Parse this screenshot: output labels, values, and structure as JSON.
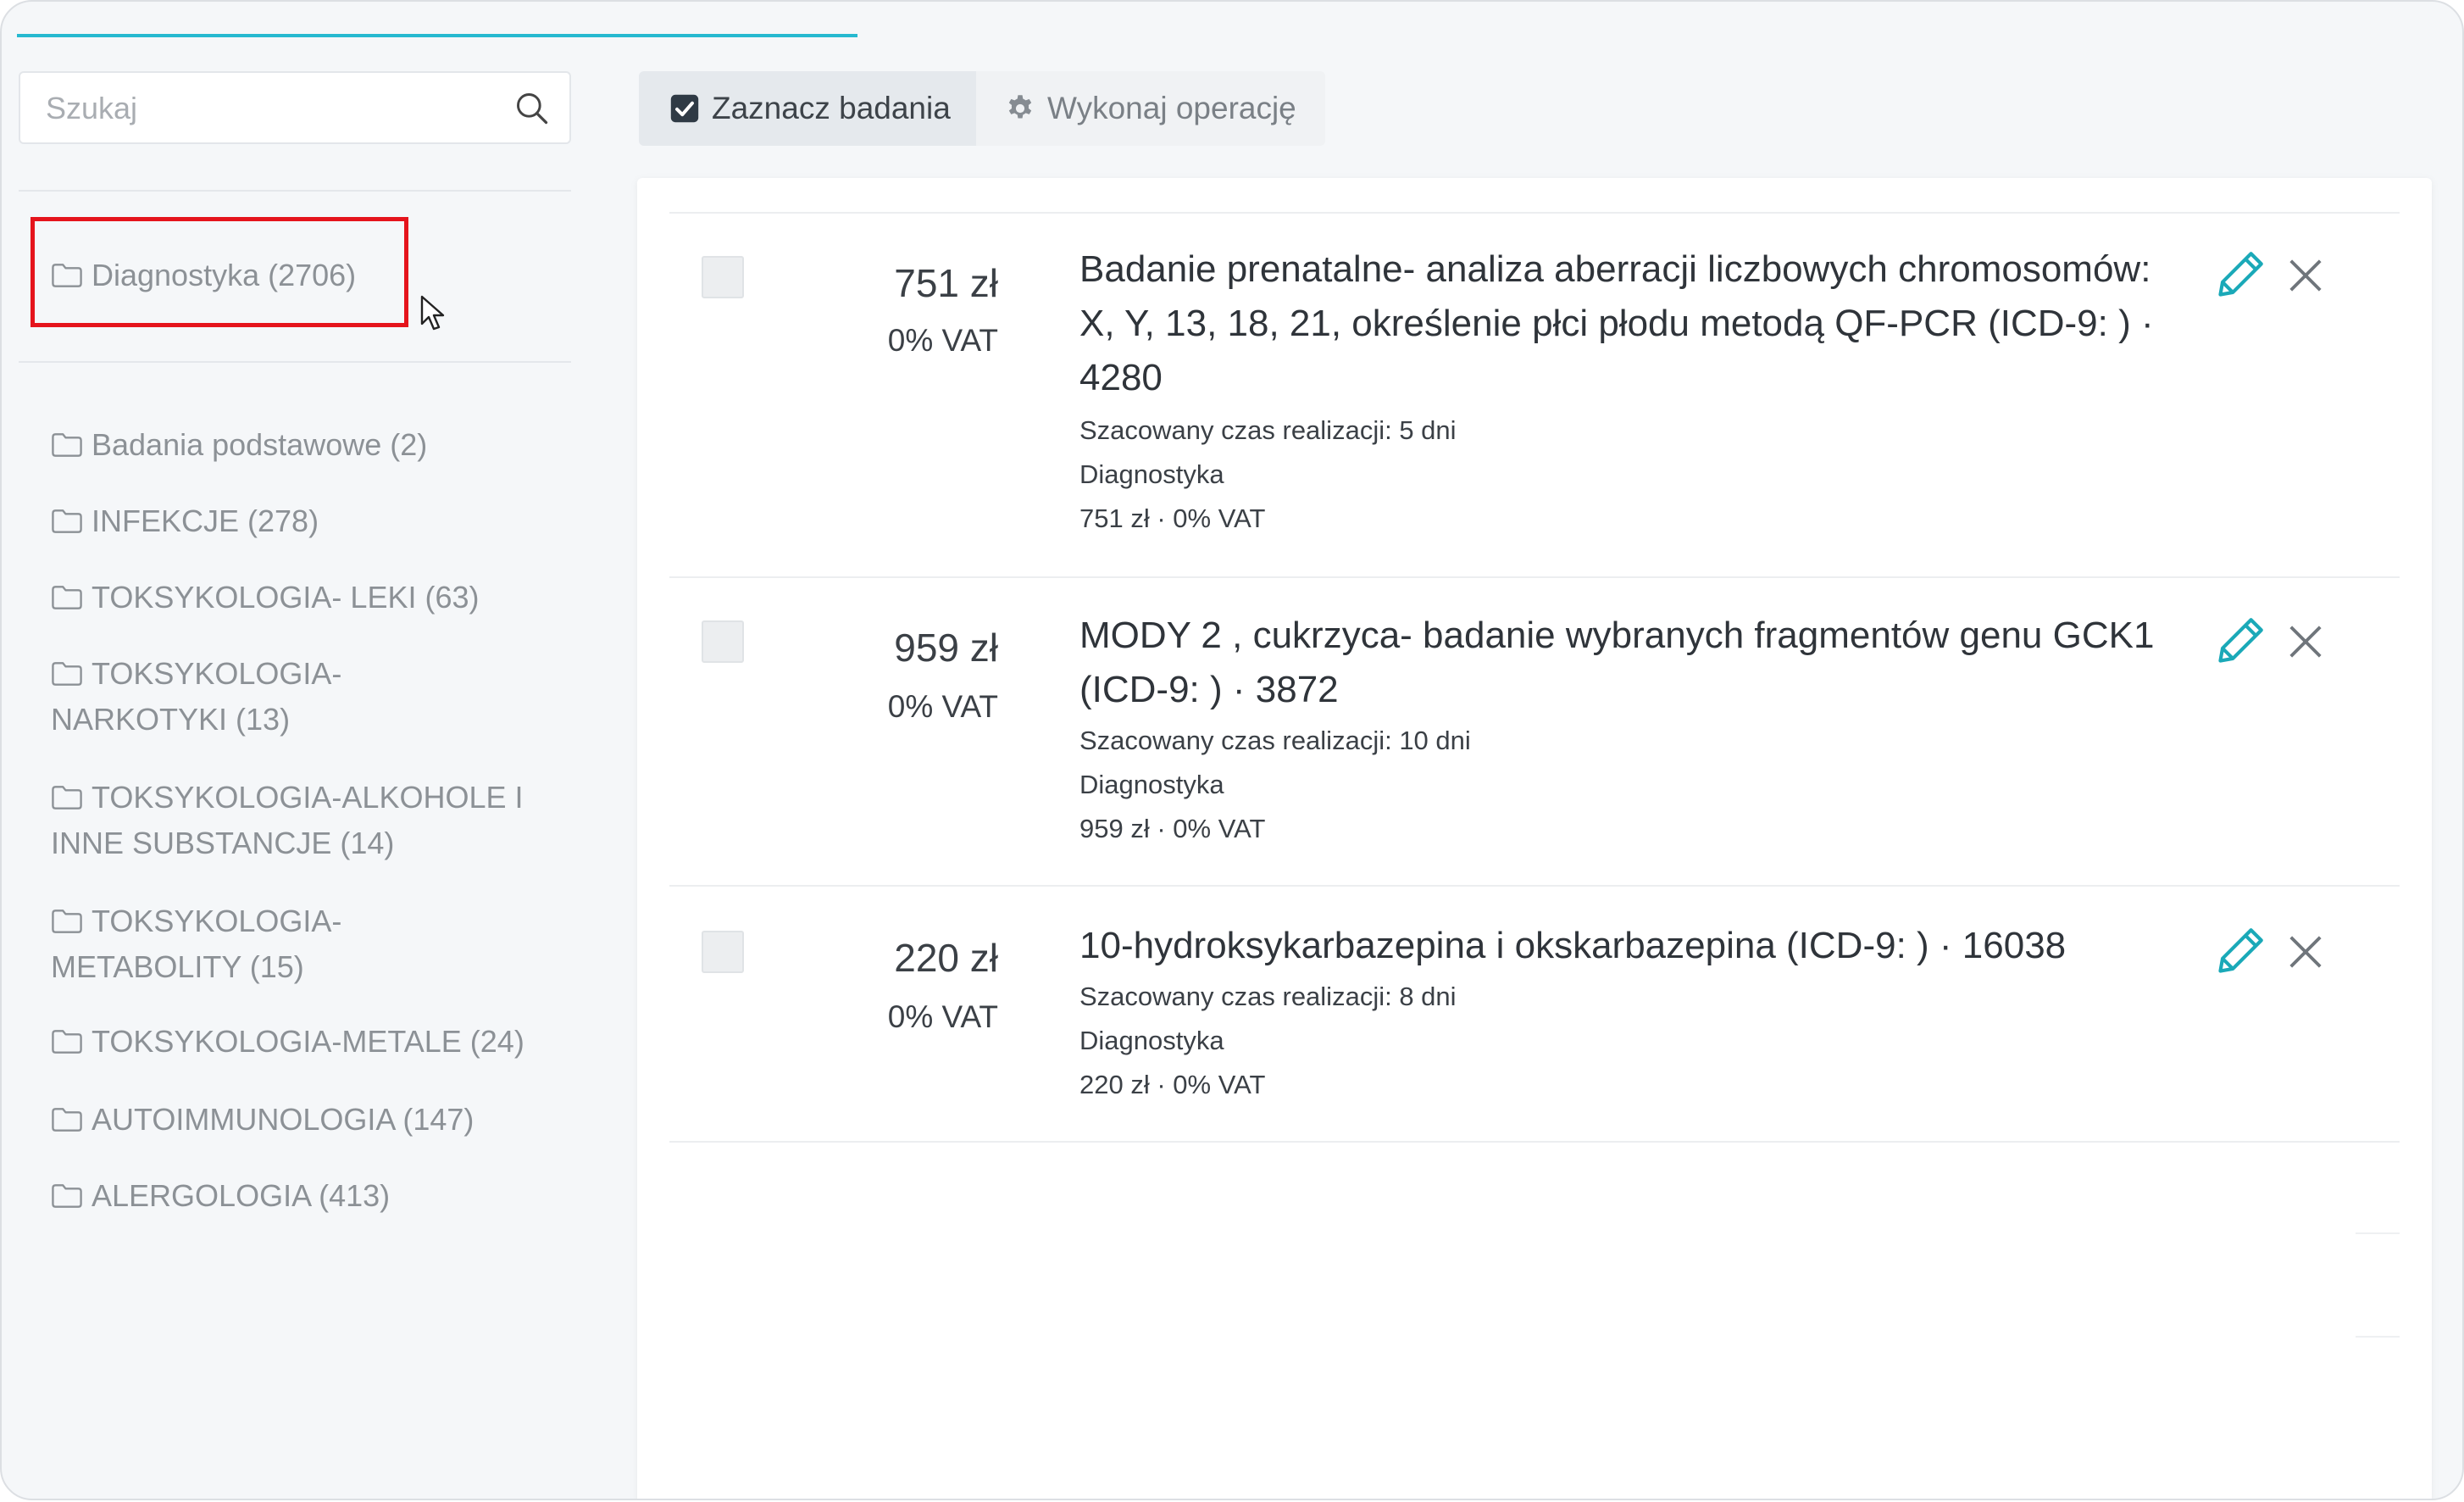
{
  "search": {
    "placeholder": "Szukaj"
  },
  "sidebar": {
    "root": {
      "label": "Diagnostyka (2706)"
    },
    "items": [
      {
        "label": "Badania podstawowe (2)"
      },
      {
        "label": "INFEKCJE (278)"
      },
      {
        "label": "TOKSYKOLOGIA- LEKI (63)"
      },
      {
        "label": "TOKSYKOLOGIA-NARKOTYKI (13)"
      },
      {
        "label": "TOKSYKOLOGIA-ALKOHOLE I INNE SUBSTANCJE (14)"
      },
      {
        "label": "TOKSYKOLOGIA-METABOLITY (15)"
      },
      {
        "label": "TOKSYKOLOGIA-METALE (24)"
      },
      {
        "label": "AUTOIMMUNOLOGIA (147)"
      },
      {
        "label": "ALERGOLOGIA (413)"
      }
    ]
  },
  "toolbar": {
    "select_label": "Zaznacz badania",
    "operations_label": "Wykonaj operację"
  },
  "tests": [
    {
      "price": "751 zł",
      "vat": "0% VAT",
      "title": "Badanie prenatalne- analiza aberracji liczbowych chromosomów: X, Y, 13, 18, 21, określenie płci płodu metodą QF-PCR (ICD-9: ) · 4280",
      "duration": "Szacowany czas realizacji: 5 dni",
      "category": "Diagnostyka",
      "price_summary": "751 zł · 0% VAT"
    },
    {
      "price": "959 zł",
      "vat": "0% VAT",
      "title": "MODY 2 , cukrzyca- badanie wybranych fragmentów genu GCK1 (ICD-9: ) · 3872",
      "duration": "Szacowany czas realizacji: 10 dni",
      "category": "Diagnostyka",
      "price_summary": "959 zł · 0% VAT"
    },
    {
      "price": "220 zł",
      "vat": "0% VAT",
      "title": "10-hydroksykarbazepina i okskarbazepina (ICD-9: ) · 16038",
      "duration": "Szacowany czas realizacji: 8 dni",
      "category": "Diagnostyka",
      "price_summary": "220 zł · 0% VAT"
    }
  ],
  "colors": {
    "accent": "#26b9d0",
    "highlight": "#e5141c",
    "icon_teal": "#1aa9b8"
  }
}
